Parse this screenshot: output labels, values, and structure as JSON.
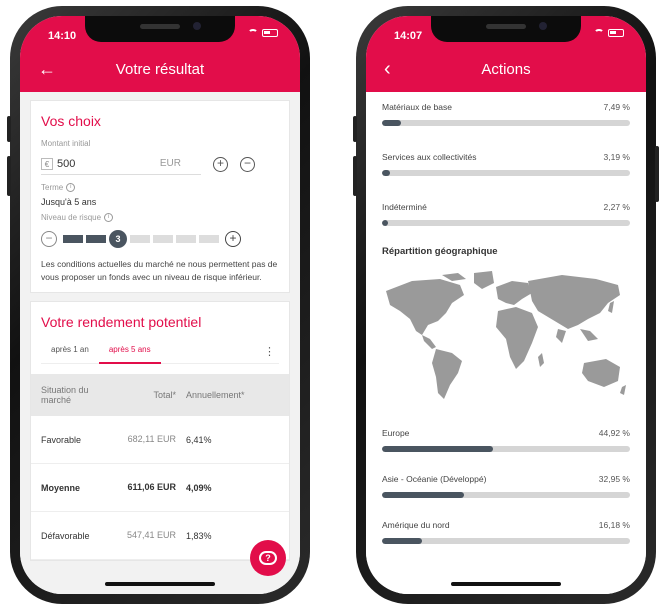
{
  "left_phone": {
    "status": {
      "time": "14:10"
    },
    "header": {
      "title": "Votre résultat"
    },
    "choices": {
      "heading": "Vos choix",
      "amount_label": "Montant initial",
      "currency_icon": "€",
      "amount_value": "500",
      "amount_currency": "EUR",
      "term_label": "Terme",
      "term_value": "Jusqu'à 5 ans",
      "risk_label": "Niveau de risque",
      "risk_level": 3,
      "risk_max": 7,
      "note": "Les conditions actuelles du marché ne nous permettent pas de vous proposer un fonds avec un niveau de risque inférieur."
    },
    "yield": {
      "heading": "Votre rendement potentiel",
      "tabs": [
        "après 1 an",
        "après 5 ans"
      ],
      "active_tab": 1,
      "table": {
        "headers": [
          "Situation du marché",
          "Total*",
          "Annuellement*"
        ],
        "rows": [
          {
            "situation": "Favorable",
            "total": "682,11 EUR",
            "annual": "6,41%"
          },
          {
            "situation": "Moyenne",
            "total": "611,06 EUR",
            "annual": "4,09%"
          },
          {
            "situation": "Défavorable",
            "total": "547,41 EUR",
            "annual": "1,83%"
          }
        ]
      }
    }
  },
  "right_phone": {
    "status": {
      "time": "14:07"
    },
    "header": {
      "title": "Actions"
    },
    "sectors": [
      {
        "name": "Matériaux de base",
        "pct": "7,49 %",
        "value": 7.49
      },
      {
        "name": "Services aux collectivités",
        "pct": "3,19 %",
        "value": 3.19
      },
      {
        "name": "Indéterminé",
        "pct": "2,27 %",
        "value": 2.27
      }
    ],
    "geo_title": "Répartition géographique",
    "regions": [
      {
        "name": "Europe",
        "pct": "44,92 %",
        "value": 44.92
      },
      {
        "name": "Asie - Océanie (Développé)",
        "pct": "32,95 %",
        "value": 32.95
      },
      {
        "name": "Amérique du nord",
        "pct": "16,18 %",
        "value": 16.18
      }
    ]
  },
  "colors": {
    "brand": "#e20d4a",
    "bar_fill": "#4a5560",
    "bar_track": "#d5d5d5"
  }
}
